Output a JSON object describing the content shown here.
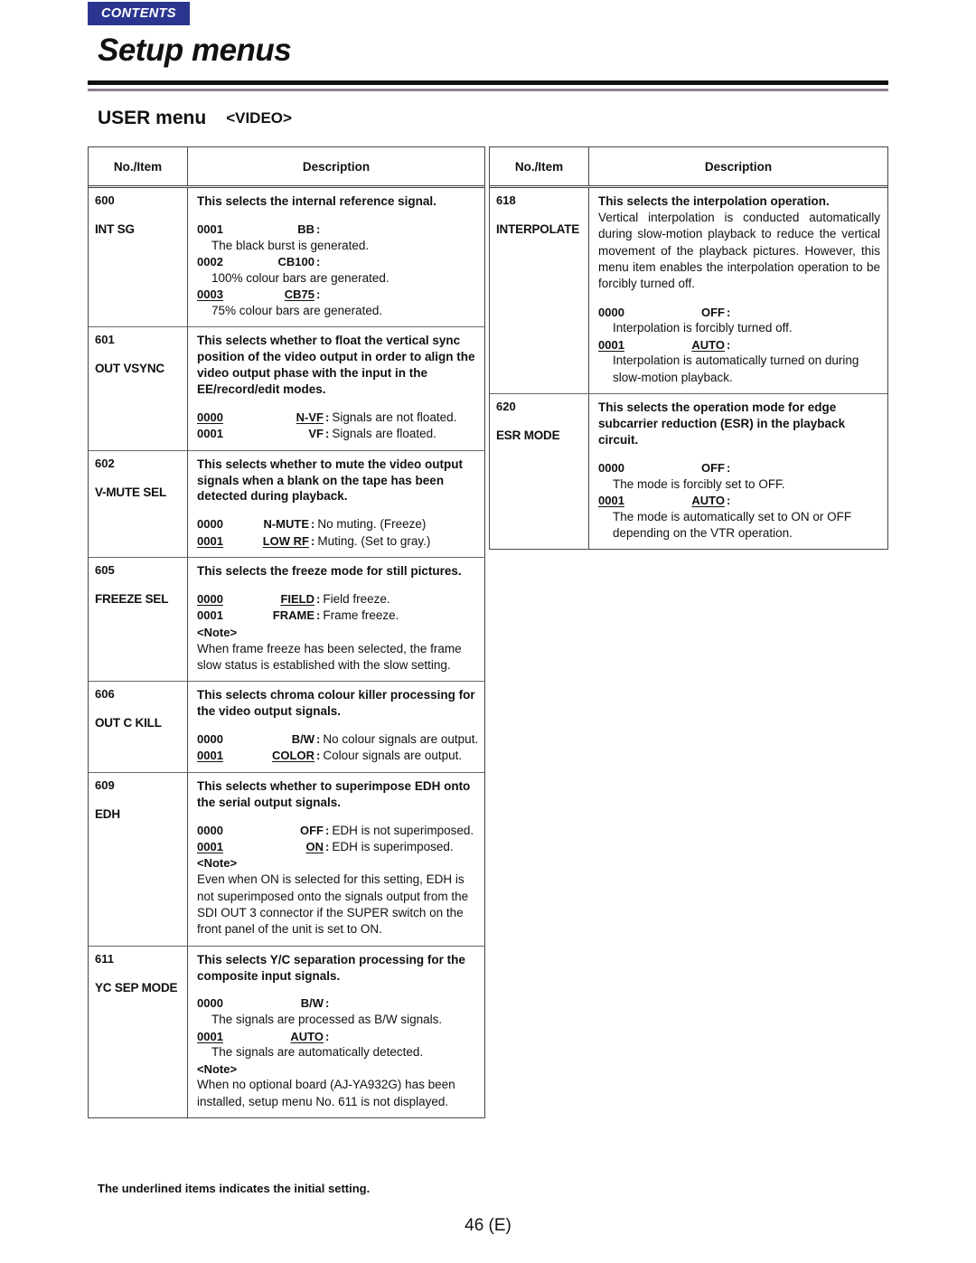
{
  "header": {
    "contents_tab": "CONTENTS",
    "title": "Setup menus",
    "section": "USER menu",
    "section_sub": "<VIDEO>",
    "accent_color": "#2b3590",
    "rule_color": "#111111",
    "rule_secondary_color": "#8c7f90"
  },
  "table_headers": {
    "no_item": "No./Item",
    "description": "Description"
  },
  "left_table": {
    "rows": [
      {
        "no": "600",
        "item": "INT SG",
        "head": "This selects the internal reference signal.",
        "opts": [
          {
            "code": "0001",
            "val": "BB",
            "text": "",
            "underline": false
          },
          {
            "sub": "The black burst is generated."
          },
          {
            "code": "0002",
            "val": "CB100",
            "text": "",
            "underline": false
          },
          {
            "sub": "100% colour bars are generated."
          },
          {
            "code": "0003",
            "val": "CB75",
            "text": "",
            "underline": true
          },
          {
            "sub": "75% colour bars are generated."
          }
        ]
      },
      {
        "no": "601",
        "item": "OUT VSYNC",
        "head": "This selects whether to float the vertical sync position of the video output in order to align the video output phase with the input in the EE/record/edit modes.",
        "opts": [
          {
            "code": "0000",
            "val": "N-VF",
            "text": "Signals are not floated.",
            "underline": true
          },
          {
            "code": "0001",
            "val": "VF",
            "text": "Signals are floated.",
            "underline": false
          }
        ]
      },
      {
        "no": "602",
        "item": "V-MUTE SEL",
        "head": "This selects whether to mute the video output signals when a blank on the tape has been detected during playback.",
        "opts": [
          {
            "code": "0000",
            "val": "N-MUTE",
            "text": "No muting. (Freeze)",
            "underline": false
          },
          {
            "code": "0001",
            "val": "LOW RF",
            "text": "Muting. (Set to gray.)",
            "underline": true
          }
        ]
      },
      {
        "no": "605",
        "item": "FREEZE SEL",
        "head": "This selects the freeze mode for still pictures.",
        "opts": [
          {
            "code": "0000",
            "val": "FIELD",
            "text": "Field freeze.",
            "underline": true
          },
          {
            "code": "0001",
            "val": "FRAME",
            "text": "Frame freeze.",
            "underline": false
          }
        ],
        "note_label": "<Note>",
        "note_text": "When frame freeze has been selected, the frame slow status is established with the slow setting."
      },
      {
        "no": "606",
        "item": "OUT C KILL",
        "head": "This selects chroma colour killer processing for the video output signals.",
        "opts": [
          {
            "code": "0000",
            "val": "B/W",
            "text": "No colour signals are output.",
            "underline": false
          },
          {
            "code": "0001",
            "val": "COLOR",
            "text": "Colour signals are output.",
            "underline": true
          }
        ]
      },
      {
        "no": "609",
        "item": "EDH",
        "head": "This selects whether to superimpose EDH onto the serial output signals.",
        "opts": [
          {
            "code": "0000",
            "val": "OFF",
            "text": "EDH is not superimposed.",
            "underline": false
          },
          {
            "code": "0001",
            "val": "ON",
            "text": "EDH is superimposed.",
            "underline": true
          }
        ],
        "note_label": "<Note>",
        "note_text": "Even when ON is selected for this setting, EDH is not superimposed onto the signals output from the SDI OUT 3 connector if the SUPER switch on the front panel of the unit is set to ON."
      },
      {
        "no": "611",
        "item": "YC SEP MODE",
        "head": "This selects Y/C separation processing for the composite input signals.",
        "opts": [
          {
            "code": "0000",
            "val": "B/W",
            "text": "",
            "underline": false
          },
          {
            "sub": "The signals are processed as B/W signals."
          },
          {
            "code": "0001",
            "val": "AUTO",
            "text": "",
            "underline": true
          },
          {
            "sub": "The signals are automatically detected."
          }
        ],
        "note_label": "<Note>",
        "note_text": "When no optional board (AJ-YA932G) has been installed, setup menu No. 611 is not displayed."
      }
    ]
  },
  "right_table": {
    "rows": [
      {
        "no": "618",
        "item": "INTERPOLATE",
        "head": "This selects the interpolation operation.",
        "body": "Vertical interpolation is conducted automatically during slow-motion playback to reduce the vertical movement of the playback pictures. However, this menu item enables the interpolation operation to be forcibly turned off.",
        "opts": [
          {
            "code": "0000",
            "val": "OFF",
            "text": "",
            "underline": false
          },
          {
            "sub": "Interpolation is forcibly turned off."
          },
          {
            "code": "0001",
            "val": "AUTO",
            "text": "",
            "underline": true
          },
          {
            "sub": "Interpolation is automatically turned on during slow-motion playback."
          }
        ]
      },
      {
        "no": "620",
        "item": "ESR MODE",
        "head": "This selects the operation mode for edge subcarrier reduction (ESR) in the playback circuit.",
        "opts": [
          {
            "code": "0000",
            "val": "OFF",
            "text": "",
            "underline": false
          },
          {
            "sub": "The mode is forcibly set to OFF."
          },
          {
            "code": "0001",
            "val": "AUTO",
            "text": "",
            "underline": true
          },
          {
            "sub": "The mode is automatically set to ON or OFF depending on the VTR operation."
          }
        ]
      }
    ]
  },
  "footer": {
    "note": "The underlined items indicates the initial setting.",
    "page": "46 (E)"
  }
}
